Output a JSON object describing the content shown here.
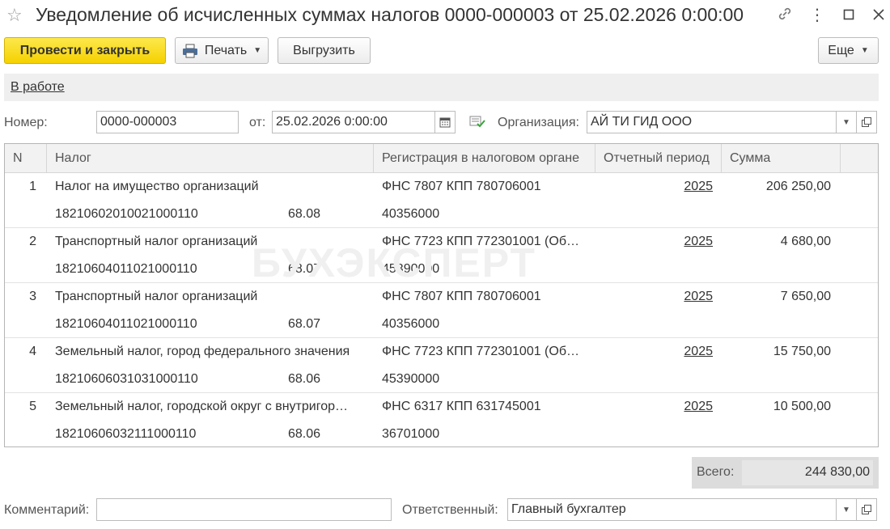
{
  "window": {
    "title": "Уведомление об исчисленных суммах налогов 0000-000003 от 25.02.2026 0:00:00"
  },
  "toolbar": {
    "post_close_label": "Провести и закрыть",
    "print_label": "Печать",
    "export_label": "Выгрузить",
    "more_label": "Еще"
  },
  "status": {
    "label": "В работе"
  },
  "form": {
    "number_label": "Номер:",
    "number_value": "0000-000003",
    "date_label": "от:",
    "date_value": "25.02.2026  0:00:00",
    "org_label": "Организация:",
    "org_value": "АЙ ТИ ГИД ООО",
    "comment_label": "Комментарий:",
    "comment_value": "",
    "responsible_label": "Ответственный:",
    "responsible_value": "Главный бухгалтер"
  },
  "table": {
    "headers": {
      "n": "N",
      "tax": "Налог",
      "reg": "Регистрация в налоговом органе",
      "period": "Отчетный период",
      "sum": "Сумма"
    },
    "rows": [
      {
        "n": "1",
        "tax": "Налог на имущество организаций",
        "kbk": "18210602010021000110",
        "account": "68.08",
        "reg": "ФНС 7807 КПП 780706001",
        "oktmo": "40356000",
        "period": "2025",
        "sum": "206 250,00"
      },
      {
        "n": "2",
        "tax": "Транспортный налог организаций",
        "kbk": "18210604011021000110",
        "account": "68.07",
        "reg": "ФНС 7723 КПП 772301001 (Об…",
        "oktmo": "45390000",
        "period": "2025",
        "sum": "4 680,00"
      },
      {
        "n": "3",
        "tax": "Транспортный налог организаций",
        "kbk": "18210604011021000110",
        "account": "68.07",
        "reg": "ФНС 7807 КПП 780706001",
        "oktmo": "40356000",
        "period": "2025",
        "sum": "7 650,00"
      },
      {
        "n": "4",
        "tax": "Земельный налог, город федерального значения",
        "kbk": "18210606031031000110",
        "account": "68.06",
        "reg": "ФНС 7723 КПП 772301001 (Об…",
        "oktmo": "45390000",
        "period": "2025",
        "sum": "15 750,00"
      },
      {
        "n": "5",
        "tax": "Земельный налог, городской округ с внутригор…",
        "kbk": "18210606032111000110",
        "account": "68.06",
        "reg": "ФНС 6317 КПП 631745001",
        "oktmo": "36701000",
        "period": "2025",
        "sum": "10 500,00"
      }
    ]
  },
  "total": {
    "label": "Всего:",
    "value": "244 830,00"
  },
  "watermark": "БУХЭКСПЕРТ"
}
